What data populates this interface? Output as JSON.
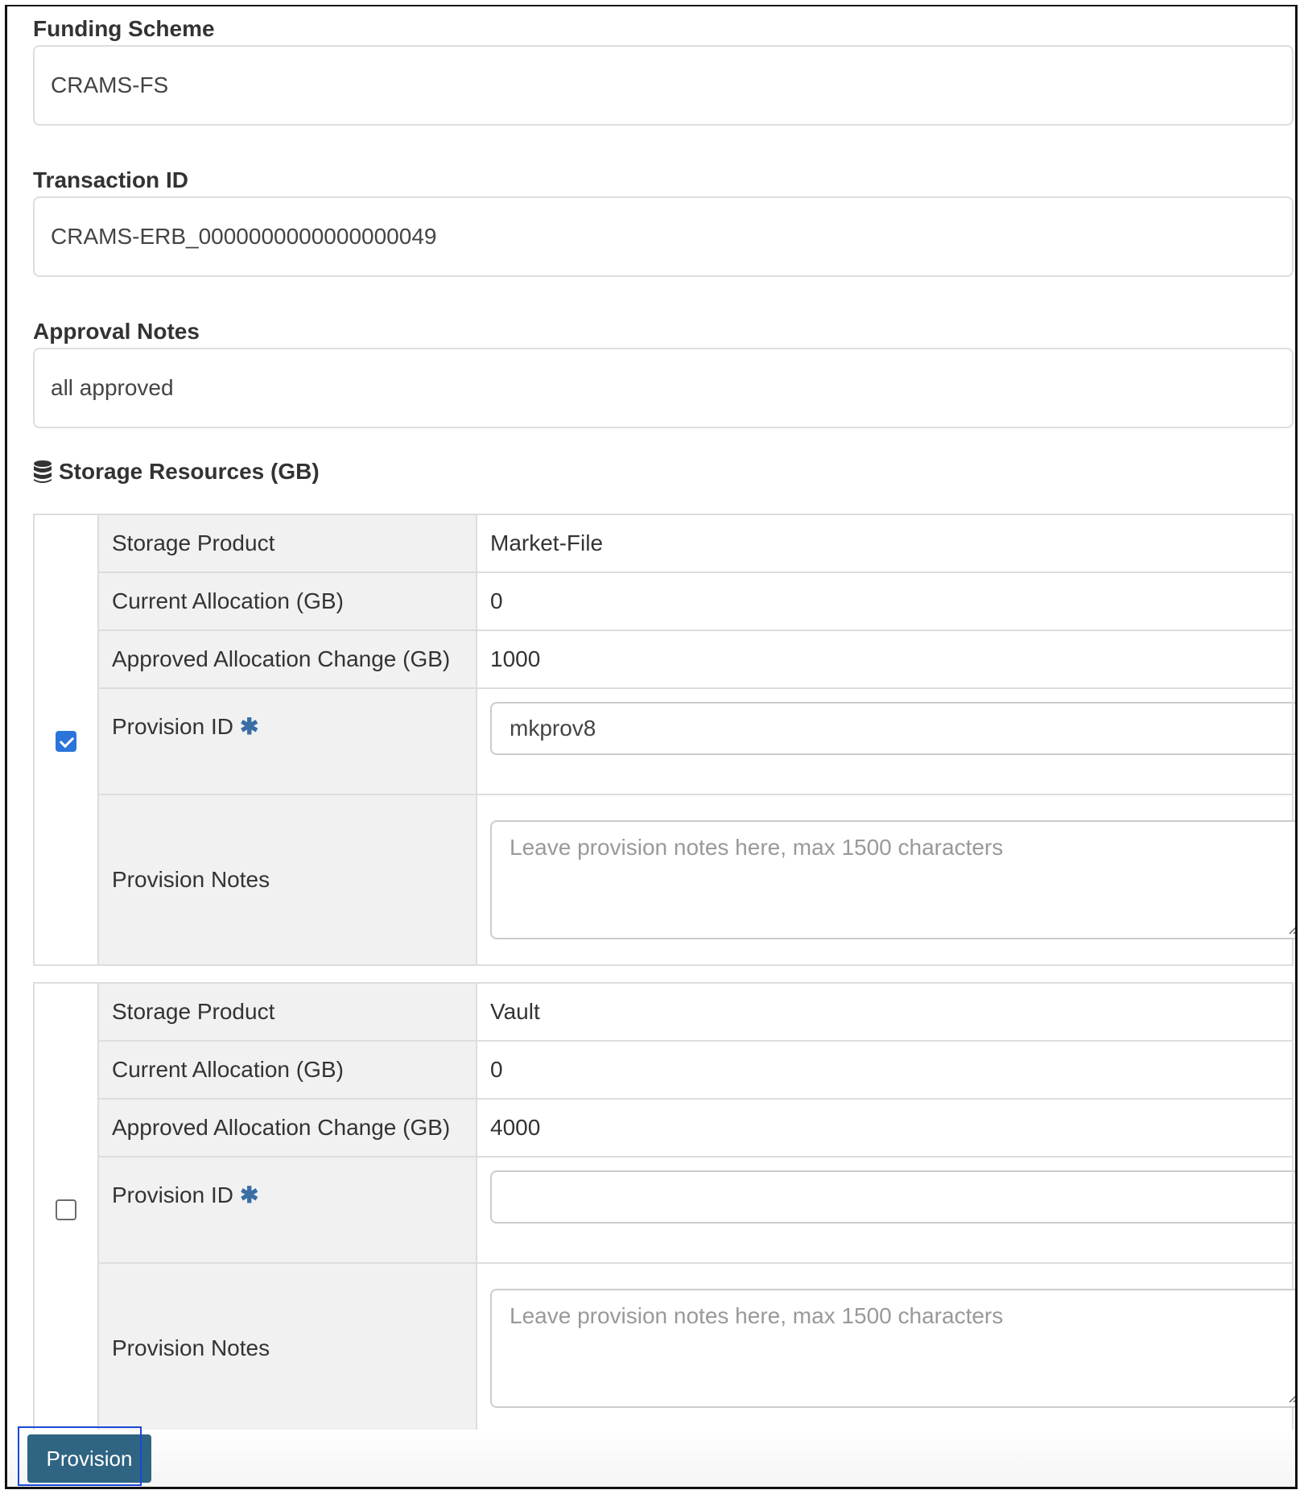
{
  "form": {
    "funding_scheme": {
      "label": "Funding Scheme",
      "value": "CRAMS-FS"
    },
    "transaction_id": {
      "label": "Transaction ID",
      "value": "CRAMS-ERB_0000000000000000049"
    },
    "approval_notes": {
      "label": "Approval Notes",
      "value": "all approved"
    }
  },
  "storage": {
    "title": "Storage Resources (GB)",
    "icon": "database-icon",
    "resources": [
      {
        "checked": true,
        "rows": {
          "product_label": "Storage Product",
          "product_value": "Market-File",
          "current_label": "Current Allocation (GB)",
          "current_value": "0",
          "change_label": "Approved Allocation Change (GB)",
          "change_value": "1000",
          "provision_id_label": "Provision ID",
          "provision_id_value": "mkprov8",
          "notes_label": "Provision Notes",
          "notes_placeholder": "Leave provision notes here, max 1500 characters"
        }
      },
      {
        "checked": false,
        "rows": {
          "product_label": "Storage Product",
          "product_value": "Vault",
          "current_label": "Current Allocation (GB)",
          "current_value": "0",
          "change_label": "Approved Allocation Change (GB)",
          "change_value": "4000",
          "provision_id_label": "Provision ID",
          "provision_id_value": "",
          "notes_label": "Provision Notes",
          "notes_placeholder": "Leave provision notes here, max 1500 characters"
        }
      }
    ]
  },
  "required_icon": "asterisk-icon",
  "colors": {
    "button": "#2f6482",
    "checkbox_checked": "#2a74da",
    "required": "#3a6ea5",
    "focus_ring": "#1a48d8"
  },
  "actions": {
    "provision_label": "Provision"
  }
}
